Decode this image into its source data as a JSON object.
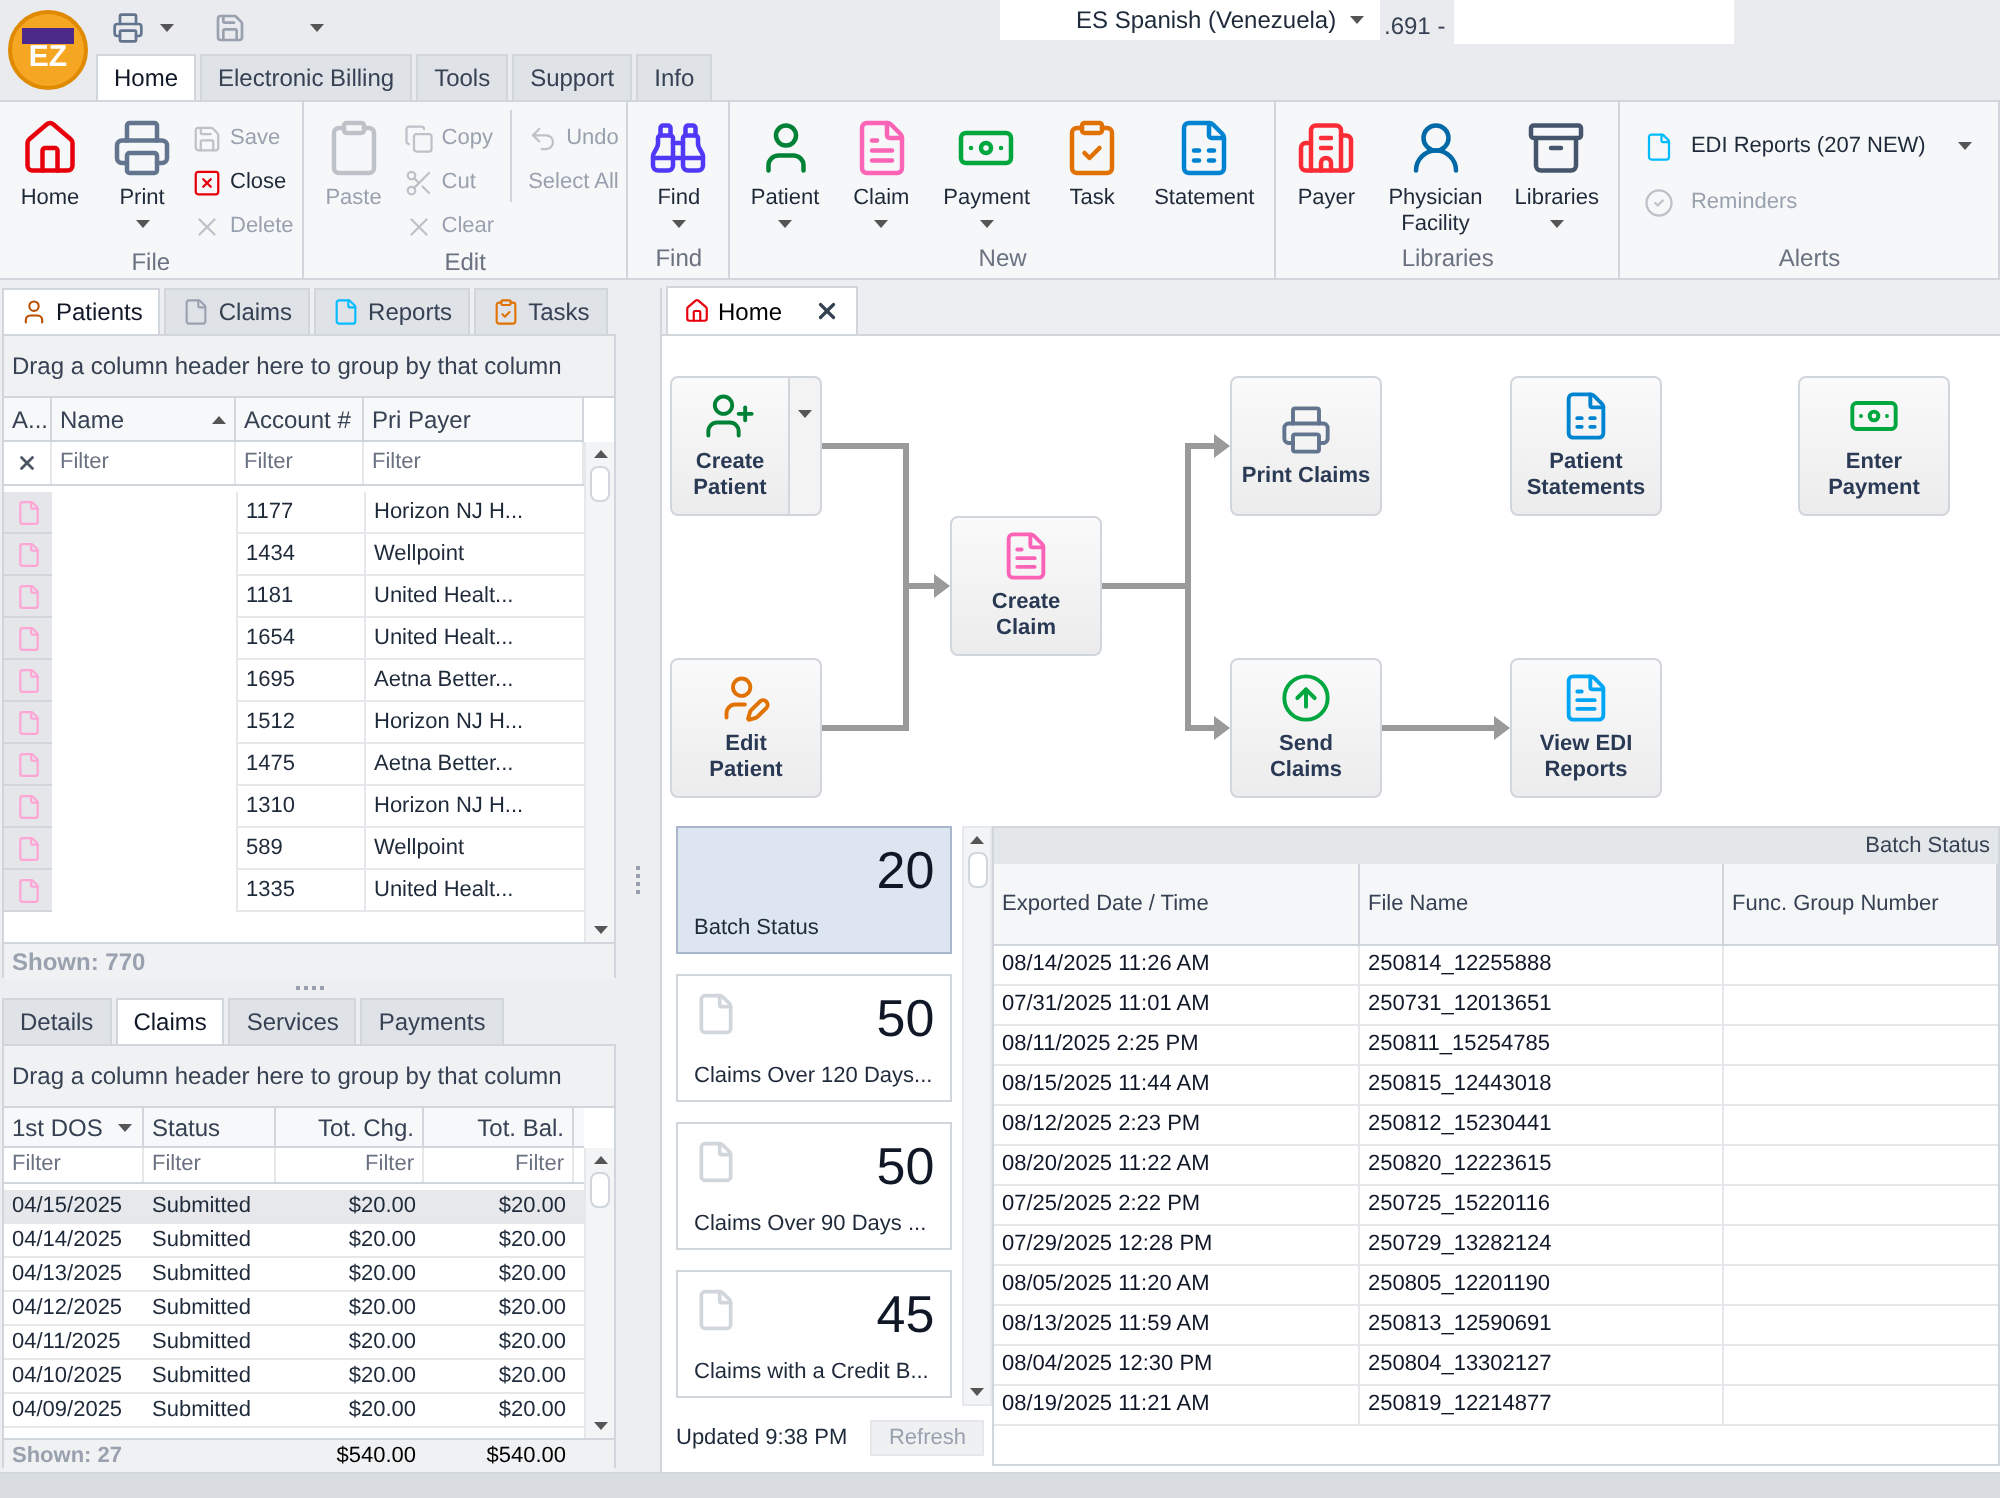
{
  "app": {
    "logo_text": "EZ",
    "language": "ES Spanish (Venezuela)",
    "version_fragment": ".691 -"
  },
  "ribbon_tabs": [
    {
      "label": "Home",
      "selected": true
    },
    {
      "label": "Electronic Billing",
      "selected": false
    },
    {
      "label": "Tools",
      "selected": false
    },
    {
      "label": "Support",
      "selected": false
    },
    {
      "label": "Info",
      "selected": false
    }
  ],
  "ribbon_groups": [
    {
      "label": "File",
      "items": [
        {
          "kind": "large",
          "label": "Home",
          "disabled": false,
          "dropdown": false
        },
        {
          "kind": "large",
          "label": "Print",
          "disabled": false,
          "dropdown": true
        },
        {
          "kind": "small",
          "label": "Save",
          "disabled": true,
          "dropdown": false
        },
        {
          "kind": "small",
          "label": "Close",
          "disabled": false,
          "dropdown": false
        },
        {
          "kind": "small",
          "label": "Delete",
          "disabled": true,
          "dropdown": false
        }
      ]
    },
    {
      "label": "Edit",
      "items": [
        {
          "kind": "large",
          "label": "Paste",
          "disabled": true,
          "dropdown": false
        },
        {
          "kind": "small",
          "label": "Copy",
          "disabled": true,
          "dropdown": false
        },
        {
          "kind": "small",
          "label": "Cut",
          "disabled": true,
          "dropdown": false
        },
        {
          "kind": "small",
          "label": "Clear",
          "disabled": true,
          "dropdown": false
        },
        {
          "kind": "small",
          "label": "Undo",
          "disabled": true,
          "dropdown": false
        },
        {
          "kind": "small",
          "label": "Select All",
          "disabled": true,
          "dropdown": false
        }
      ]
    },
    {
      "label": "Find",
      "items": [
        {
          "kind": "large",
          "label": "Find",
          "disabled": false,
          "dropdown": true
        }
      ]
    },
    {
      "label": "New",
      "items": [
        {
          "kind": "large",
          "label": "Patient",
          "disabled": false,
          "dropdown": true
        },
        {
          "kind": "large",
          "label": "Claim",
          "disabled": false,
          "dropdown": true
        },
        {
          "kind": "large",
          "label": "Payment",
          "disabled": false,
          "dropdown": true
        },
        {
          "kind": "large",
          "label": "Task",
          "disabled": false,
          "dropdown": false
        },
        {
          "kind": "large",
          "label": "Statement",
          "disabled": false,
          "dropdown": false
        }
      ]
    },
    {
      "label": "Libraries",
      "items": [
        {
          "kind": "large",
          "label": "Payer",
          "disabled": false,
          "dropdown": false
        },
        {
          "kind": "large",
          "label": "Physician\nFacility",
          "disabled": false,
          "dropdown": false
        },
        {
          "kind": "large",
          "label": "Libraries",
          "disabled": false,
          "dropdown": true
        }
      ]
    },
    {
      "label": "Alerts",
      "items": [
        {
          "kind": "row",
          "label": "EDI Reports (207 NEW)",
          "disabled": false,
          "dropdown": true
        },
        {
          "kind": "row",
          "label": "Reminders",
          "disabled": true,
          "dropdown": false
        }
      ]
    }
  ],
  "side_tabs": [
    {
      "label": "Patients",
      "selected": true
    },
    {
      "label": "Claims",
      "selected": false
    },
    {
      "label": "Reports",
      "selected": false
    },
    {
      "label": "Tasks",
      "selected": false
    }
  ],
  "patients_grid": {
    "group_hint": "Drag a column header here to group by that column",
    "columns": [
      {
        "label": "A..."
      },
      {
        "label": "Name",
        "sort_ascending": true,
        "placeholder": "Filter"
      },
      {
        "label": "Account #",
        "placeholder": "Filter"
      },
      {
        "label": "Pri Payer",
        "placeholder": "Filter"
      }
    ],
    "rows": [
      {
        "account": "1177",
        "payer": "Horizon NJ H..."
      },
      {
        "account": "1434",
        "payer": "Wellpoint"
      },
      {
        "account": "1181",
        "payer": "United Healt..."
      },
      {
        "account": "1654",
        "payer": "United Healt..."
      },
      {
        "account": "1695",
        "payer": "Aetna Better..."
      },
      {
        "account": "1512",
        "payer": "Horizon NJ H..."
      },
      {
        "account": "1475",
        "payer": "Aetna Better..."
      },
      {
        "account": "1310",
        "payer": "Horizon NJ H..."
      },
      {
        "account": "589",
        "payer": "Wellpoint"
      },
      {
        "account": "1335",
        "payer": "United Healt..."
      }
    ],
    "shown": "Shown: 770"
  },
  "detail_tabs": [
    {
      "label": "Details",
      "selected": false
    },
    {
      "label": "Claims",
      "selected": true
    },
    {
      "label": "Services",
      "selected": false
    },
    {
      "label": "Payments",
      "selected": false
    }
  ],
  "claims_grid": {
    "group_hint": "Drag a column header here to group by that column",
    "columns": [
      {
        "label": "1st DOS",
        "sort_ascending": false,
        "placeholder": "Filter"
      },
      {
        "label": "Status",
        "placeholder": "Filter"
      },
      {
        "label": "Tot. Chg.",
        "placeholder": "Filter"
      },
      {
        "label": "Tot. Bal.",
        "placeholder": "Filter"
      }
    ],
    "rows": [
      {
        "dos": "04/15/2025",
        "status": "Submitted",
        "charge": "$20.00",
        "balance": "$20.00",
        "selected": true
      },
      {
        "dos": "04/14/2025",
        "status": "Submitted",
        "charge": "$20.00",
        "balance": "$20.00",
        "selected": false
      },
      {
        "dos": "04/13/2025",
        "status": "Submitted",
        "charge": "$20.00",
        "balance": "$20.00",
        "selected": false
      },
      {
        "dos": "04/12/2025",
        "status": "Submitted",
        "charge": "$20.00",
        "balance": "$20.00",
        "selected": false
      },
      {
        "dos": "04/11/2025",
        "status": "Submitted",
        "charge": "$20.00",
        "balance": "$20.00",
        "selected": false
      },
      {
        "dos": "04/10/2025",
        "status": "Submitted",
        "charge": "$20.00",
        "balance": "$20.00",
        "selected": false
      },
      {
        "dos": "04/09/2025",
        "status": "Submitted",
        "charge": "$20.00",
        "balance": "$20.00",
        "selected": false
      }
    ],
    "shown": "Shown: 27",
    "total_charge": "$540.00",
    "total_balance": "$540.00"
  },
  "document_tab": {
    "label": "Home"
  },
  "workflow": [
    {
      "label": "Create\nPatient",
      "dropdown": true
    },
    {
      "label": "Print Claims",
      "dropdown": false
    },
    {
      "label": "Patient\nStatements",
      "dropdown": false
    },
    {
      "label": "Enter\nPayment",
      "dropdown": false
    },
    {
      "label": "Create\nClaim",
      "dropdown": false
    },
    {
      "label": "Edit\nPatient",
      "dropdown": false
    },
    {
      "label": "Send\nClaims",
      "dropdown": false
    },
    {
      "label": "View EDI\nReports",
      "dropdown": false
    }
  ],
  "tiles": [
    {
      "kind": "plain",
      "count": "20",
      "label": "Batch Status",
      "selected": true
    },
    {
      "kind": "document",
      "count": "50",
      "label": "Claims Over 120 Days...",
      "selected": false
    },
    {
      "kind": "document",
      "count": "50",
      "label": "Claims Over 90 Days ...",
      "selected": false
    },
    {
      "kind": "document",
      "count": "45",
      "label": "Claims with a Credit B...",
      "selected": false
    }
  ],
  "updated": "Updated 9:38 PM",
  "refresh": "Refresh",
  "batch_grid": {
    "title": "Batch Status",
    "columns": [
      "Exported Date / Time",
      "File Name",
      "Func. Group Number"
    ],
    "rows": [
      {
        "exported": "08/14/2025 11:26 AM",
        "file_name": "250814_12255888"
      },
      {
        "exported": "07/31/2025 11:01 AM",
        "file_name": "250731_12013651"
      },
      {
        "exported": "08/11/2025 2:25 PM",
        "file_name": "250811_15254785"
      },
      {
        "exported": "08/15/2025 11:44 AM",
        "file_name": "250815_12443018"
      },
      {
        "exported": "08/12/2025 2:23 PM",
        "file_name": "250812_15230441"
      },
      {
        "exported": "08/20/2025 11:22 AM",
        "file_name": "250820_12223615"
      },
      {
        "exported": "07/25/2025 2:22 PM",
        "file_name": "250725_15220116"
      },
      {
        "exported": "07/29/2025 12:28 PM",
        "file_name": "250729_13282124"
      },
      {
        "exported": "08/05/2025 11:20 AM",
        "file_name": "250805_12201190"
      },
      {
        "exported": "08/13/2025 11:59 AM",
        "file_name": "250813_12590691"
      },
      {
        "exported": "08/04/2025 12:30 PM",
        "file_name": "250804_13302127"
      },
      {
        "exported": "08/19/2025 11:21 AM",
        "file_name": "250819_12214877"
      }
    ]
  }
}
